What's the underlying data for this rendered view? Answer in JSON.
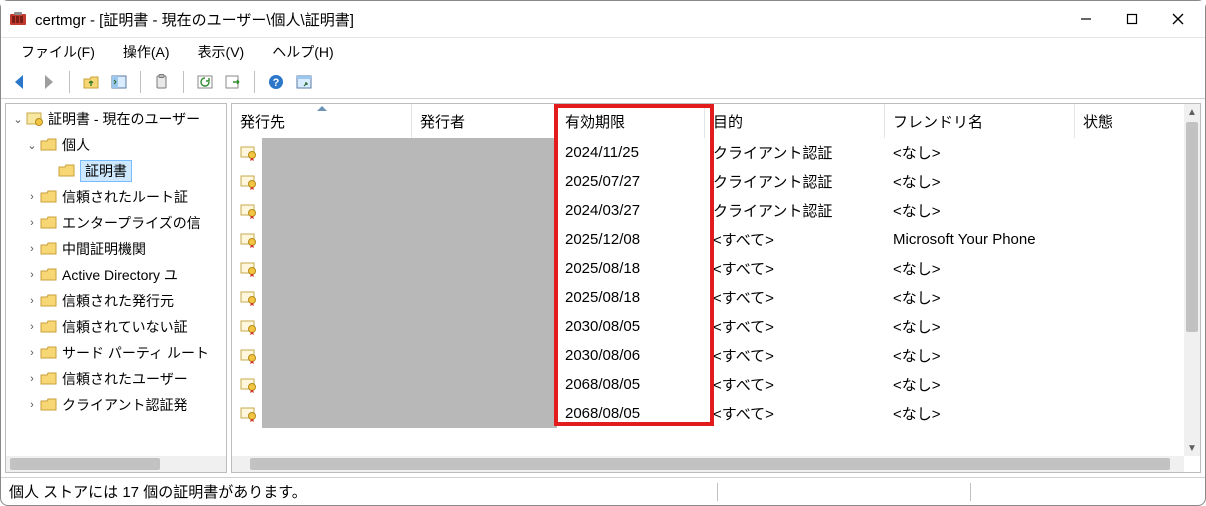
{
  "window": {
    "title": "certmgr - [証明書 - 現在のユーザー\\個人\\証明書]"
  },
  "menu": {
    "file": "ファイル(F)",
    "action": "操作(A)",
    "view": "表示(V)",
    "help": "ヘルプ(H)"
  },
  "tree": {
    "root": "証明書 - 現在のユーザー",
    "nodes": [
      {
        "label": "個人",
        "expanded": true,
        "level": 1
      },
      {
        "label": "証明書",
        "selected": true,
        "level": 2
      },
      {
        "label": "信頼されたルート証",
        "level": 1
      },
      {
        "label": "エンタープライズの信",
        "level": 1
      },
      {
        "label": "中間証明機関",
        "level": 1
      },
      {
        "label": "Active Directory ユ",
        "level": 1
      },
      {
        "label": "信頼された発行元",
        "level": 1
      },
      {
        "label": "信頼されていない証",
        "level": 1
      },
      {
        "label": "サード パーティ ルート",
        "level": 1
      },
      {
        "label": "信頼されたユーザー",
        "level": 1
      },
      {
        "label": "クライアント認証発",
        "level": 1
      }
    ]
  },
  "columns": {
    "issued_to": "発行先",
    "issuer": "発行者",
    "expiry": "有効期限",
    "purpose": "目的",
    "friendly": "フレンドリ名",
    "status": "状態"
  },
  "rows": [
    {
      "expiry": "2024/11/25",
      "purpose": "クライアント認証",
      "friendly": "<なし>"
    },
    {
      "expiry": "2025/07/27",
      "purpose": "クライアント認証",
      "friendly": "<なし>"
    },
    {
      "expiry": "2024/03/27",
      "purpose": "クライアント認証",
      "friendly": "<なし>"
    },
    {
      "expiry": "2025/12/08",
      "purpose": "<すべて>",
      "friendly": "Microsoft Your Phone"
    },
    {
      "expiry": "2025/08/18",
      "purpose": "<すべて>",
      "friendly": "<なし>"
    },
    {
      "expiry": "2025/08/18",
      "purpose": "<すべて>",
      "friendly": "<なし>"
    },
    {
      "expiry": "2030/08/05",
      "purpose": "<すべて>",
      "friendly": "<なし>"
    },
    {
      "expiry": "2030/08/06",
      "purpose": "<すべて>",
      "friendly": "<なし>"
    },
    {
      "expiry": "2068/08/05",
      "purpose": "<すべて>",
      "friendly": "<なし>"
    },
    {
      "expiry": "2068/08/05",
      "purpose": "<すべて>",
      "friendly": "<なし>"
    }
  ],
  "status": {
    "text": "個人 ストアには 17 個の証明書があります。"
  }
}
